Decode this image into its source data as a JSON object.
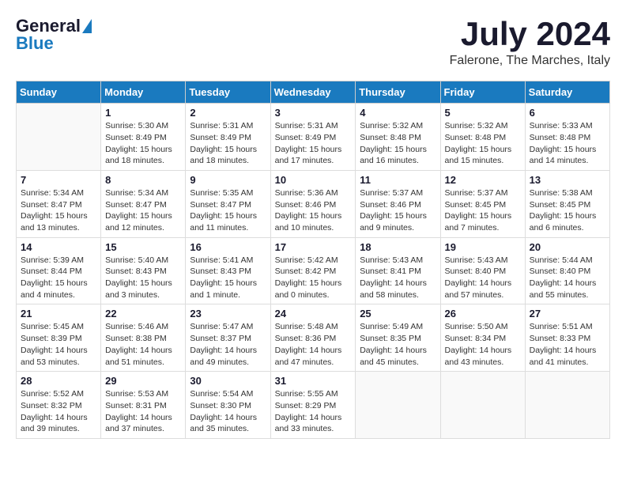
{
  "logo": {
    "general": "General",
    "blue": "Blue"
  },
  "header": {
    "month": "July 2024",
    "location": "Falerone, The Marches, Italy"
  },
  "days_of_week": [
    "Sunday",
    "Monday",
    "Tuesday",
    "Wednesday",
    "Thursday",
    "Friday",
    "Saturday"
  ],
  "weeks": [
    [
      {
        "day": "",
        "info": ""
      },
      {
        "day": "1",
        "info": "Sunrise: 5:30 AM\nSunset: 8:49 PM\nDaylight: 15 hours\nand 18 minutes."
      },
      {
        "day": "2",
        "info": "Sunrise: 5:31 AM\nSunset: 8:49 PM\nDaylight: 15 hours\nand 18 minutes."
      },
      {
        "day": "3",
        "info": "Sunrise: 5:31 AM\nSunset: 8:49 PM\nDaylight: 15 hours\nand 17 minutes."
      },
      {
        "day": "4",
        "info": "Sunrise: 5:32 AM\nSunset: 8:48 PM\nDaylight: 15 hours\nand 16 minutes."
      },
      {
        "day": "5",
        "info": "Sunrise: 5:32 AM\nSunset: 8:48 PM\nDaylight: 15 hours\nand 15 minutes."
      },
      {
        "day": "6",
        "info": "Sunrise: 5:33 AM\nSunset: 8:48 PM\nDaylight: 15 hours\nand 14 minutes."
      }
    ],
    [
      {
        "day": "7",
        "info": "Sunrise: 5:34 AM\nSunset: 8:47 PM\nDaylight: 15 hours\nand 13 minutes."
      },
      {
        "day": "8",
        "info": "Sunrise: 5:34 AM\nSunset: 8:47 PM\nDaylight: 15 hours\nand 12 minutes."
      },
      {
        "day": "9",
        "info": "Sunrise: 5:35 AM\nSunset: 8:47 PM\nDaylight: 15 hours\nand 11 minutes."
      },
      {
        "day": "10",
        "info": "Sunrise: 5:36 AM\nSunset: 8:46 PM\nDaylight: 15 hours\nand 10 minutes."
      },
      {
        "day": "11",
        "info": "Sunrise: 5:37 AM\nSunset: 8:46 PM\nDaylight: 15 hours\nand 9 minutes."
      },
      {
        "day": "12",
        "info": "Sunrise: 5:37 AM\nSunset: 8:45 PM\nDaylight: 15 hours\nand 7 minutes."
      },
      {
        "day": "13",
        "info": "Sunrise: 5:38 AM\nSunset: 8:45 PM\nDaylight: 15 hours\nand 6 minutes."
      }
    ],
    [
      {
        "day": "14",
        "info": "Sunrise: 5:39 AM\nSunset: 8:44 PM\nDaylight: 15 hours\nand 4 minutes."
      },
      {
        "day": "15",
        "info": "Sunrise: 5:40 AM\nSunset: 8:43 PM\nDaylight: 15 hours\nand 3 minutes."
      },
      {
        "day": "16",
        "info": "Sunrise: 5:41 AM\nSunset: 8:43 PM\nDaylight: 15 hours\nand 1 minute."
      },
      {
        "day": "17",
        "info": "Sunrise: 5:42 AM\nSunset: 8:42 PM\nDaylight: 15 hours\nand 0 minutes."
      },
      {
        "day": "18",
        "info": "Sunrise: 5:43 AM\nSunset: 8:41 PM\nDaylight: 14 hours\nand 58 minutes."
      },
      {
        "day": "19",
        "info": "Sunrise: 5:43 AM\nSunset: 8:40 PM\nDaylight: 14 hours\nand 57 minutes."
      },
      {
        "day": "20",
        "info": "Sunrise: 5:44 AM\nSunset: 8:40 PM\nDaylight: 14 hours\nand 55 minutes."
      }
    ],
    [
      {
        "day": "21",
        "info": "Sunrise: 5:45 AM\nSunset: 8:39 PM\nDaylight: 14 hours\nand 53 minutes."
      },
      {
        "day": "22",
        "info": "Sunrise: 5:46 AM\nSunset: 8:38 PM\nDaylight: 14 hours\nand 51 minutes."
      },
      {
        "day": "23",
        "info": "Sunrise: 5:47 AM\nSunset: 8:37 PM\nDaylight: 14 hours\nand 49 minutes."
      },
      {
        "day": "24",
        "info": "Sunrise: 5:48 AM\nSunset: 8:36 PM\nDaylight: 14 hours\nand 47 minutes."
      },
      {
        "day": "25",
        "info": "Sunrise: 5:49 AM\nSunset: 8:35 PM\nDaylight: 14 hours\nand 45 minutes."
      },
      {
        "day": "26",
        "info": "Sunrise: 5:50 AM\nSunset: 8:34 PM\nDaylight: 14 hours\nand 43 minutes."
      },
      {
        "day": "27",
        "info": "Sunrise: 5:51 AM\nSunset: 8:33 PM\nDaylight: 14 hours\nand 41 minutes."
      }
    ],
    [
      {
        "day": "28",
        "info": "Sunrise: 5:52 AM\nSunset: 8:32 PM\nDaylight: 14 hours\nand 39 minutes."
      },
      {
        "day": "29",
        "info": "Sunrise: 5:53 AM\nSunset: 8:31 PM\nDaylight: 14 hours\nand 37 minutes."
      },
      {
        "day": "30",
        "info": "Sunrise: 5:54 AM\nSunset: 8:30 PM\nDaylight: 14 hours\nand 35 minutes."
      },
      {
        "day": "31",
        "info": "Sunrise: 5:55 AM\nSunset: 8:29 PM\nDaylight: 14 hours\nand 33 minutes."
      },
      {
        "day": "",
        "info": ""
      },
      {
        "day": "",
        "info": ""
      },
      {
        "day": "",
        "info": ""
      }
    ]
  ]
}
